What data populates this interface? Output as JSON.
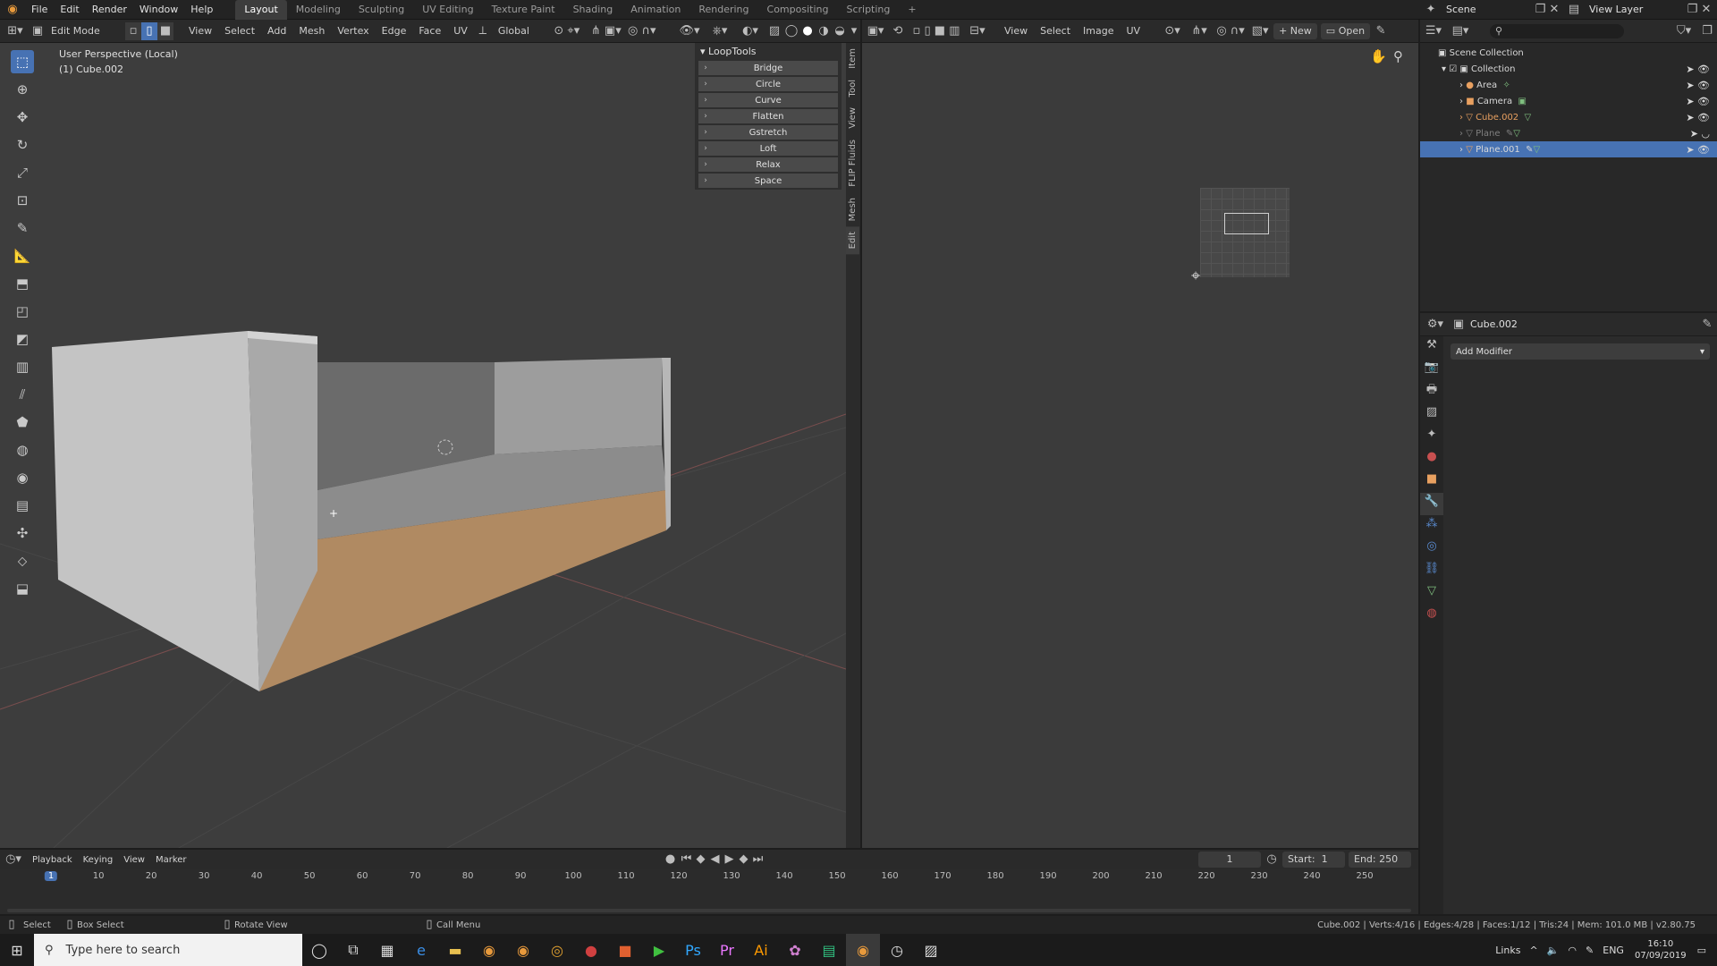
{
  "topbar": {
    "menus": [
      "File",
      "Edit",
      "Render",
      "Window",
      "Help"
    ],
    "workspaces": [
      "Layout",
      "Modeling",
      "Sculpting",
      "UV Editing",
      "Texture Paint",
      "Shading",
      "Animation",
      "Rendering",
      "Compositing",
      "Scripting"
    ],
    "add_tab": "+",
    "scene": "Scene",
    "view_layer": "View Layer"
  },
  "viewport_header": {
    "mode": "Edit Mode",
    "menus": [
      "View",
      "Select",
      "Add",
      "Mesh",
      "Vertex",
      "Edge",
      "Face",
      "UV"
    ],
    "orientation": "Global"
  },
  "viewport": {
    "perspective": "User Perspective (Local)",
    "object": "(1) Cube.002"
  },
  "looptools": {
    "title": "LoopTools",
    "items": [
      "Bridge",
      "Circle",
      "Curve",
      "Flatten",
      "Gstretch",
      "Loft",
      "Relax",
      "Space"
    ]
  },
  "sidetabs": [
    "Item",
    "Tool",
    "View",
    "FLIP Fluids",
    "Mesh",
    "Edit"
  ],
  "image_header": {
    "menus": [
      "View",
      "Select",
      "Image",
      "UV"
    ],
    "new": "New",
    "open": "Open"
  },
  "outliner": {
    "root": "Scene Collection",
    "collection": "Collection",
    "items": [
      {
        "name": "Area",
        "sel": false
      },
      {
        "name": "Camera",
        "sel": false
      },
      {
        "name": "Cube.002",
        "sel": false
      },
      {
        "name": "Plane",
        "sel": false
      },
      {
        "name": "Plane.001",
        "sel": true
      }
    ]
  },
  "properties": {
    "object": "Cube.002",
    "add_modifier": "Add Modifier"
  },
  "timeline": {
    "menus": [
      "Playback",
      "Keying",
      "View",
      "Marker"
    ],
    "current_frame": "1",
    "start_label": "Start:",
    "start": "1",
    "end_label": "End:",
    "end": "250",
    "ticks": [
      "1",
      "10",
      "20",
      "30",
      "40",
      "50",
      "60",
      "70",
      "80",
      "90",
      "100",
      "110",
      "120",
      "130",
      "140",
      "150",
      "160",
      "170",
      "180",
      "190",
      "200",
      "210",
      "220",
      "230",
      "240",
      "250"
    ]
  },
  "statusbar": {
    "select": "Select",
    "box_select": "Box Select",
    "rotate": "Rotate View",
    "call_menu": "Call Menu",
    "stats": "Cube.002 | Verts:4/16 | Edges:4/28 | Faces:1/12 | Tris:24 | Mem: 101.0 MB | v2.80.75"
  },
  "taskbar": {
    "search_placeholder": "Type here to search",
    "links": "Links",
    "lang": "ENG",
    "time": "16:10",
    "date": "07/09/2019"
  },
  "colors": {
    "accent": "#4772b3",
    "orange_face": "#b08a62"
  }
}
